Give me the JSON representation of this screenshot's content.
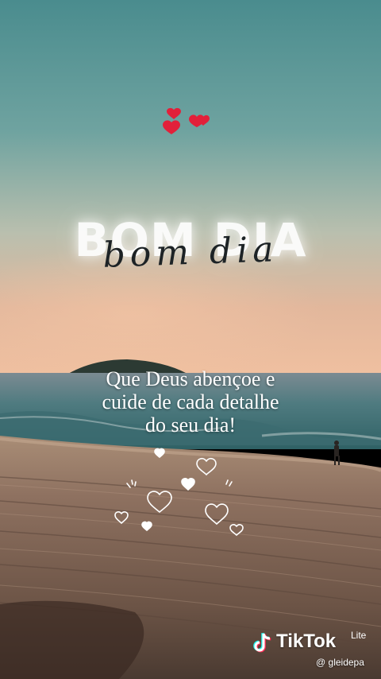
{
  "overlay": {
    "title": "BOM DIA",
    "title_script": "bom dia",
    "message_lines": [
      "Que Deus abençoe e",
      "cuide de cada detalhe",
      "do seu dia!"
    ]
  },
  "watermark": {
    "brand": "TikTok",
    "brand_suffix": "Lite",
    "username": "@ gleidepa"
  },
  "icons": [
    "heart-icon",
    "tiktok-note-icon"
  ],
  "colors": {
    "sky_top": "#4d8f90",
    "sky_horizon": "#e9b999",
    "sea": "#3f7376",
    "sand": "#7a604f",
    "heart_red": "#e2203a",
    "text": "#ffffff"
  }
}
